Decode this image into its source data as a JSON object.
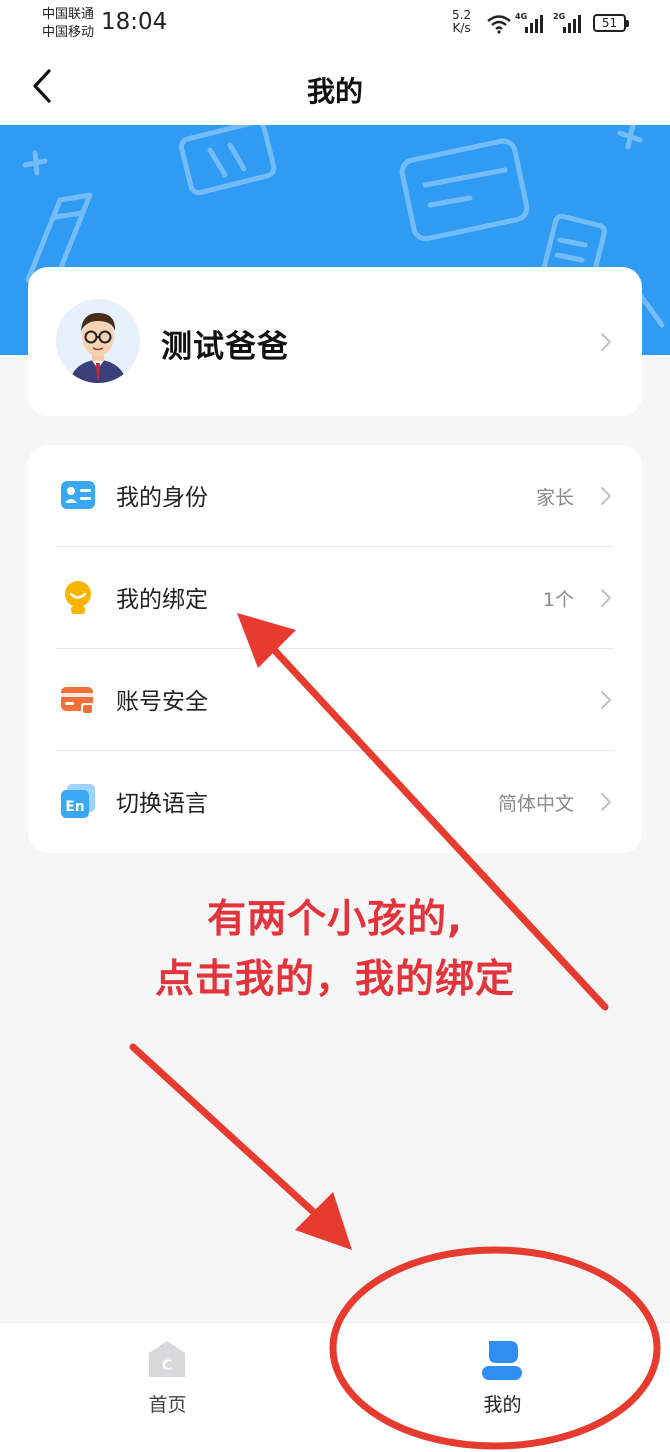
{
  "status_bar": {
    "carrier_1": "中国联通",
    "carrier_2": "中国移动",
    "time": "18:04",
    "net_speed_value": "5.2",
    "net_speed_unit": "K/s",
    "signal_1_tag": "4G",
    "signal_2_tag": "2G",
    "battery": "51"
  },
  "header": {
    "title": "我的",
    "back_icon": "chevron-left-icon"
  },
  "profile": {
    "name": "测试爸爸",
    "avatar": "avatar-man-with-glasses"
  },
  "menu": {
    "items": [
      {
        "label": "我的身份",
        "value": "家长",
        "icon": "id-card-icon",
        "color": "#3aa8f5"
      },
      {
        "label": "我的绑定",
        "value": "1个",
        "icon": "child-face-icon",
        "color": "#f7b500"
      },
      {
        "label": "账号安全",
        "value": "",
        "icon": "lock-card-icon",
        "color": "#f26f3a"
      },
      {
        "label": "切换语言",
        "value": "简体中文",
        "icon": "language-en-icon",
        "color": "#3aa8f5"
      }
    ]
  },
  "annotation": {
    "line_1": "有两个小孩的,",
    "line_2": "点击我的，我的绑定",
    "color": "#e3343c"
  },
  "tab_bar": {
    "tabs": [
      {
        "label": "首页",
        "icon": "home-icon",
        "active": false
      },
      {
        "label": "我的",
        "icon": "person-icon",
        "active": true
      }
    ],
    "active_color": "#2f8ff0"
  },
  "colors": {
    "banner": "#2f9bf3",
    "background": "#f6f6f7"
  }
}
